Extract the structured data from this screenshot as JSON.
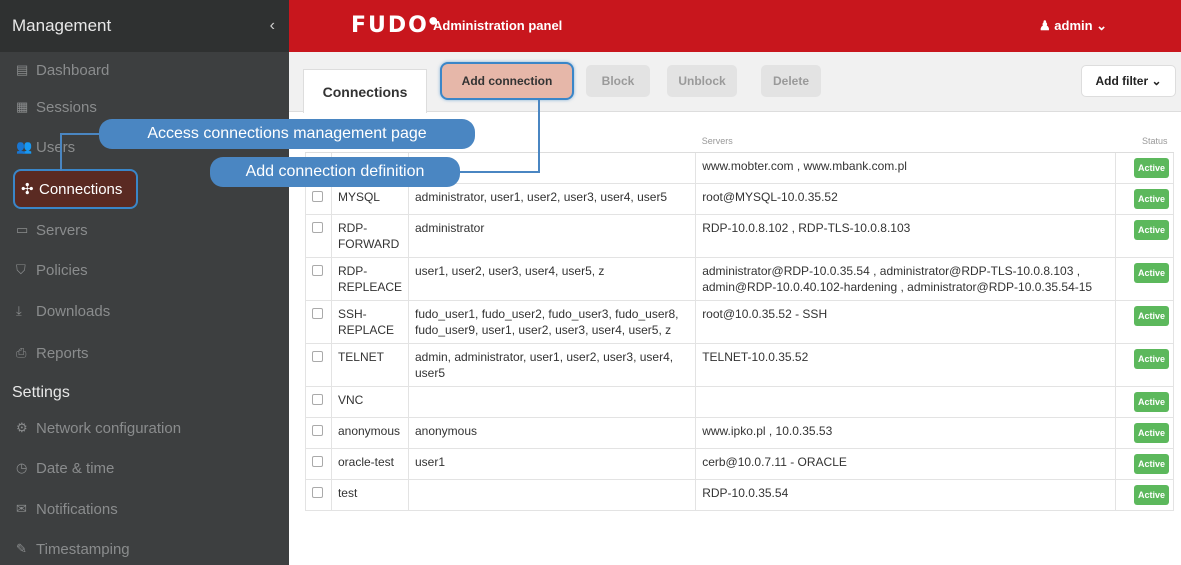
{
  "sidebar": {
    "header": "Management",
    "collapse_icon": "‹",
    "items": [
      {
        "label": "Dashboard",
        "icon": "▤"
      },
      {
        "label": "Sessions",
        "icon": "▦"
      },
      {
        "label": "Users",
        "icon": "👥"
      },
      {
        "label": "Connections",
        "icon": "✣"
      },
      {
        "label": "Servers",
        "icon": "▭"
      },
      {
        "label": "Policies",
        "icon": "⛉"
      },
      {
        "label": "Downloads",
        "icon": "⤓"
      },
      {
        "label": "Reports",
        "icon": "⎙"
      }
    ],
    "settings_header": "Settings",
    "settings_items": [
      {
        "label": "Network configuration",
        "icon": "⚙"
      },
      {
        "label": "Date & time",
        "icon": "◷"
      },
      {
        "label": "Notifications",
        "icon": "✉"
      },
      {
        "label": "Timestamping",
        "icon": "✎"
      }
    ]
  },
  "topbar": {
    "logo": "FUDO",
    "title": "Administration panel",
    "user": "admin ⌄",
    "color": "#c8161d"
  },
  "toolbar": {
    "tab": "Connections",
    "add": "Add connection",
    "block": "Block",
    "unblock": "Unblock",
    "delete": "Delete",
    "filter": "Add filter ⌄"
  },
  "table": {
    "headers": {
      "servers": "Servers",
      "status": "Status"
    },
    "rows": [
      {
        "name": "",
        "users": "",
        "servers": "www.mobter.com , www.mbank.com.pl",
        "status": "Active"
      },
      {
        "name": "MYSQL",
        "users": "administrator, user1, user2, user3, user4, user5",
        "servers": "root@MYSQL-10.0.35.52",
        "status": "Active"
      },
      {
        "name": "RDP-FORWARD",
        "users": "administrator",
        "servers": "RDP-10.0.8.102 , RDP-TLS-10.0.8.103",
        "status": "Active"
      },
      {
        "name": "RDP-REPLEACE",
        "users": "user1, user2, user3, user4, user5, z",
        "servers": "administrator@RDP-10.0.35.54 , administrator@RDP-TLS-10.0.8.103 , admin@RDP-10.0.40.102-hardening , administrator@RDP-10.0.35.54-15",
        "status": "Active"
      },
      {
        "name": "SSH-REPLACE",
        "users": "fudo_user1, fudo_user2, fudo_user3, fudo_user8, fudo_user9, user1, user2, user3, user4, user5, z",
        "servers": "root@10.0.35.52 - SSH",
        "status": "Active"
      },
      {
        "name": "TELNET",
        "users": "admin, administrator, user1, user2, user3, user4, user5",
        "servers": "TELNET-10.0.35.52",
        "status": "Active"
      },
      {
        "name": "VNC",
        "users": "",
        "servers": "",
        "status": "Active"
      },
      {
        "name": "anonymous",
        "users": "anonymous",
        "servers": "www.ipko.pl , 10.0.35.53",
        "status": "Active"
      },
      {
        "name": "oracle-test",
        "users": "user1",
        "servers": "cerb@10.0.7.11 - ORACLE",
        "status": "Active"
      },
      {
        "name": "test",
        "users": "",
        "servers": "RDP-10.0.35.54",
        "status": "Active"
      }
    ]
  },
  "callouts": {
    "access": "Access connections management page",
    "add": "Add connection definition"
  }
}
